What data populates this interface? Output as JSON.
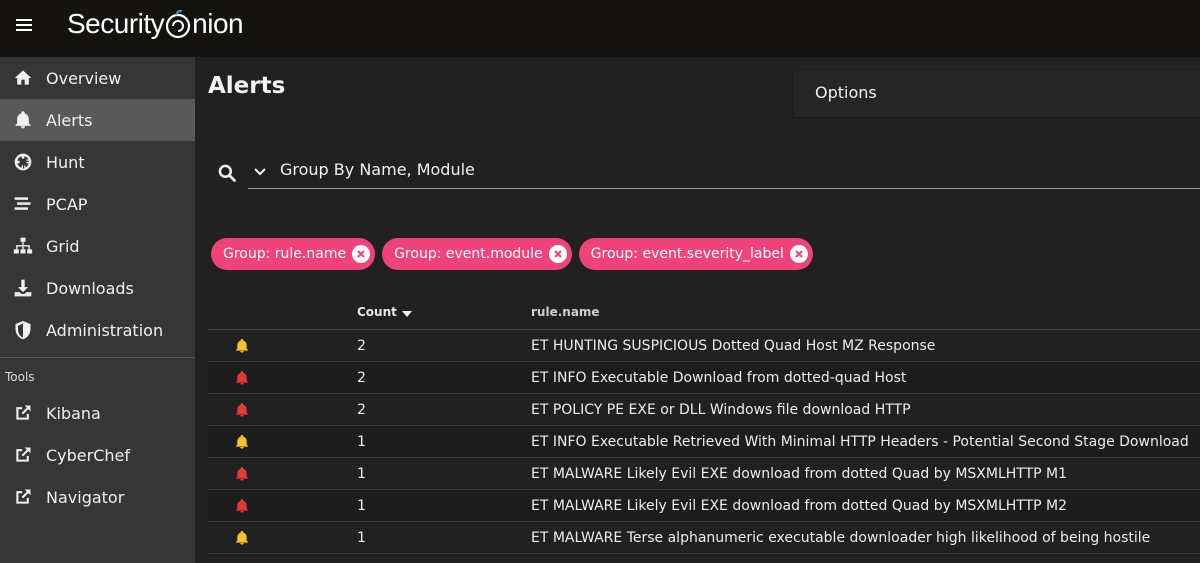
{
  "header": {
    "brand_prefix": "Security",
    "brand_suffix": "nion"
  },
  "sidebar": {
    "items": [
      {
        "label": "Overview",
        "icon": "home-icon"
      },
      {
        "label": "Alerts",
        "icon": "bell-icon",
        "active": true
      },
      {
        "label": "Hunt",
        "icon": "crosshairs-icon"
      },
      {
        "label": "PCAP",
        "icon": "stream-icon"
      },
      {
        "label": "Grid",
        "icon": "sitemap-icon"
      },
      {
        "label": "Downloads",
        "icon": "download-icon"
      },
      {
        "label": "Administration",
        "icon": "shield-icon"
      }
    ],
    "tools_label": "Tools",
    "tools": [
      {
        "label": "Kibana",
        "icon": "external-link-icon"
      },
      {
        "label": "CyberChef",
        "icon": "external-link-icon"
      },
      {
        "label": "Navigator",
        "icon": "external-link-icon"
      }
    ]
  },
  "main": {
    "title": "Alerts",
    "options_label": "Options",
    "query": "Group By Name, Module",
    "chips": [
      {
        "label": "Group: rule.name"
      },
      {
        "label": "Group: event.module"
      },
      {
        "label": "Group: event.severity_label"
      }
    ],
    "table": {
      "headers": {
        "count": "Count",
        "rule": "rule.name"
      },
      "rows": [
        {
          "severity": "medium",
          "count": "2",
          "rule": "ET HUNTING SUSPICIOUS Dotted Quad Host MZ Response"
        },
        {
          "severity": "high",
          "count": "2",
          "rule": "ET INFO Executable Download from dotted-quad Host"
        },
        {
          "severity": "high",
          "count": "2",
          "rule": "ET POLICY PE EXE or DLL Windows file download HTTP"
        },
        {
          "severity": "medium",
          "count": "1",
          "rule": "ET INFO Executable Retrieved With Minimal HTTP Headers - Potential Second Stage Download"
        },
        {
          "severity": "high",
          "count": "1",
          "rule": "ET MALWARE Likely Evil EXE download from dotted Quad by MSXMLHTTP M1"
        },
        {
          "severity": "high",
          "count": "1",
          "rule": "ET MALWARE Likely Evil EXE download from dotted Quad by MSXMLHTTP M2"
        },
        {
          "severity": "medium",
          "count": "1",
          "rule": "ET MALWARE Terse alphanumeric executable downloader high likelihood of being hostile"
        }
      ]
    }
  },
  "colors": {
    "accent_chip": "#f0437a",
    "severity_high": "#e53935",
    "severity_medium": "#fbc02d",
    "sidebar_bg": "#363636",
    "topbar_bg": "#15130f"
  }
}
